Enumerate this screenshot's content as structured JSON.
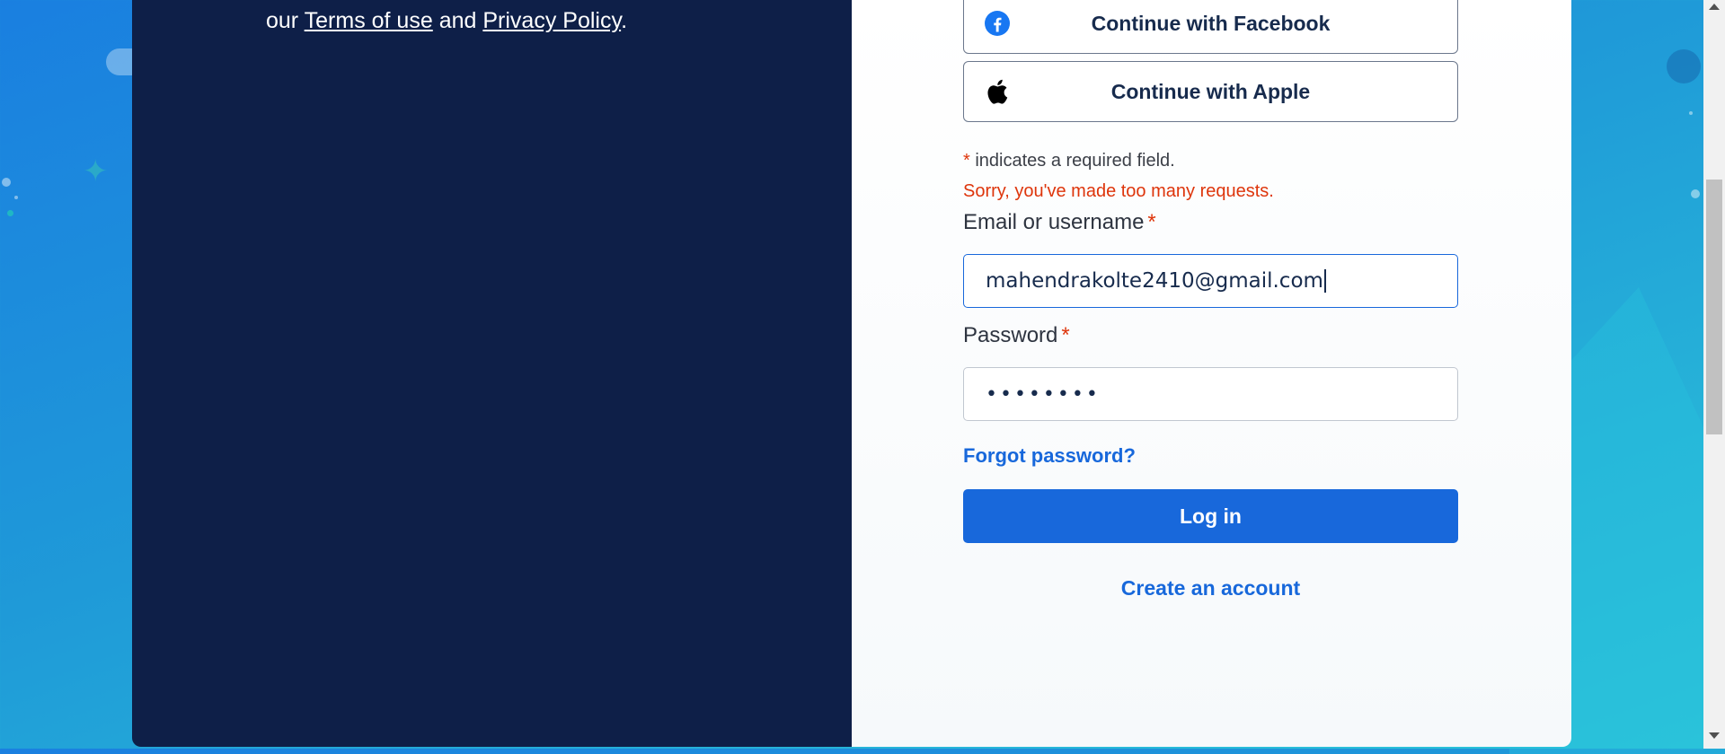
{
  "legal": {
    "prefix": "our ",
    "terms_link": "Terms of use",
    "conjunction": " and ",
    "privacy_link": "Privacy Policy",
    "suffix": "."
  },
  "social": {
    "facebook_label": "Continue with Facebook",
    "apple_label": "Continue with Apple"
  },
  "form": {
    "required_star": "*",
    "required_note": " indicates a required field.",
    "error_message": "Sorry, you've made too many requests.",
    "email_label": "Email or username",
    "email_value": "mahendrakolte2410@gmail.com",
    "password_label": "Password",
    "password_value": "••••••••",
    "forgot_link": "Forgot password?",
    "login_button": "Log in",
    "create_account": "Create an account"
  },
  "colors": {
    "panel_dark": "#0e1f48",
    "accent": "#1868db",
    "error": "#de350b",
    "facebook_blue": "#1877f2"
  },
  "icons": {
    "facebook": "facebook-icon",
    "apple": "apple-icon"
  }
}
